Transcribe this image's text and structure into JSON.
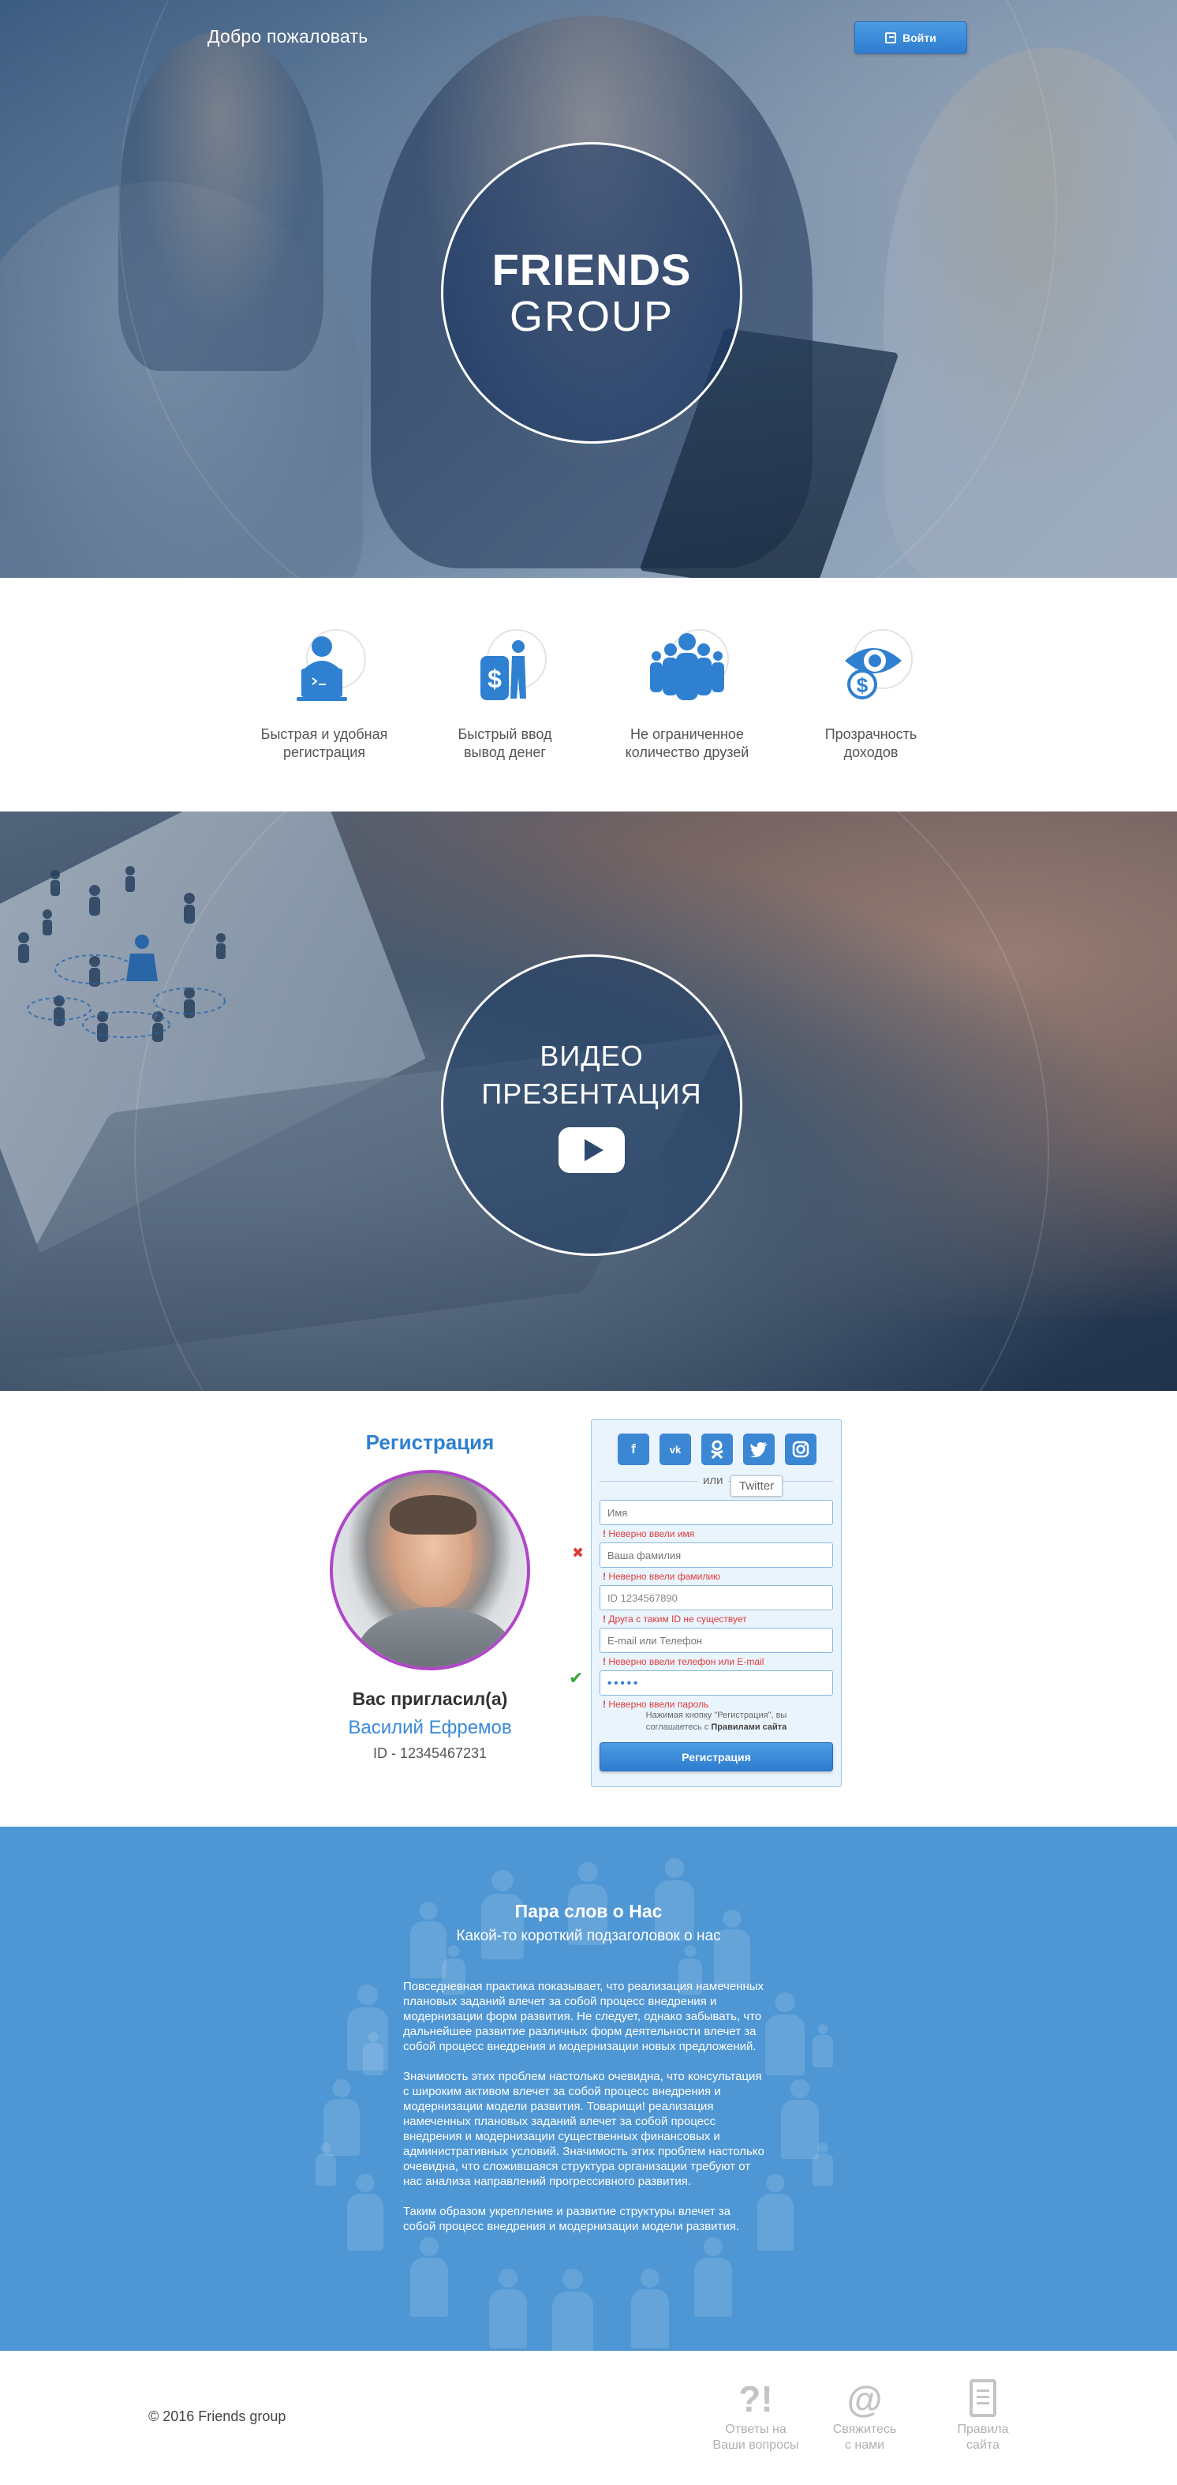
{
  "header": {
    "welcome": "Добро пожаловать",
    "login_label": "Войти",
    "logo_line1": "FRIENDS",
    "logo_line2": "GROUP"
  },
  "features": [
    {
      "icon": "user-laptop-icon",
      "line1": "Быстрая и удобная",
      "line2": "регистрация"
    },
    {
      "icon": "money-person-icon",
      "line1": "Быстрый ввод",
      "line2": "вывод денег"
    },
    {
      "icon": "group-people-icon",
      "line1": "Не ограниченное",
      "line2": "количество друзей"
    },
    {
      "icon": "eye-dollar-icon",
      "line1": "Прозрачность",
      "line2": "доходов"
    }
  ],
  "video": {
    "line1": "ВИДЕО",
    "line2": "ПРЕЗЕНТАЦИЯ"
  },
  "registration": {
    "title": "Регистрация",
    "invited_label": "Вас пригласил(а)",
    "inviter_name": "Василий Ефремов",
    "inviter_id": "ID - 12345467231",
    "socials": [
      "f",
      "vk",
      "ok",
      "twitter",
      "instagram"
    ],
    "or_label": "или",
    "tooltip": "Twitter",
    "fields": {
      "first_name_placeholder": "Имя",
      "last_name_placeholder": "Ваша фамилия",
      "id_value": "ID 1234567890",
      "contact_placeholder": "E-mail или Телефон",
      "password_value": "•••••"
    },
    "errors": {
      "first_name": "Неверно ввели имя",
      "last_name": "Неверно ввели фамилию",
      "id": "Друга с таким ID не существует",
      "contact": "Неверно ввели телефон или E-mail",
      "password": "Неверно ввели пароль"
    },
    "agree_line1": "Нажимая кнопку \"Регистрация\", вы",
    "agree_line2_prefix": "соглашаетесь с ",
    "agree_link": "Правилами сайта",
    "submit_label": "Регистрация"
  },
  "about": {
    "title": "Пара слов о Нас",
    "subtitle": "Какой-то короткий подзаголовок о нас",
    "paragraphs": [
      "Повседневная практика показывает, что реализация намеченных плановых заданий влечет за собой процесс внедрения и модернизации форм развития. Не следует, однако забывать, что дальнейшее развитие различных форм деятельности влечет за собой процесс внедрения и модернизации новых предложений.",
      "Значимость этих проблем настолько очевидна, что консультация с широким активом влечет за собой процесс внедрения и модернизации модели развития. Товарищи! реализация намеченных плановых заданий влечет за собой процесс внедрения и модернизации существенных финансовых и административных условий. Значимость этих проблем настолько очевидна, что сложившаяся структура организации требуют от нас анализа направлений прогрессивного развития.",
      "Таким образом укрепление и развитие структуры влечет за собой процесс внедрения и модернизации модели развития."
    ]
  },
  "footer": {
    "copyright": "© 2016 Friends group",
    "links": [
      {
        "icon": "question-icon",
        "glyph": "?!",
        "line1": "Ответы на",
        "line2": "Ваши вопросы"
      },
      {
        "icon": "at-icon",
        "glyph": "@",
        "line1": "Свяжитесь",
        "line2": "с нами"
      },
      {
        "icon": "document-icon",
        "glyph": "",
        "line1": "Правила",
        "line2": "сайта"
      }
    ]
  },
  "colors": {
    "brand_blue": "#2f80d1",
    "about_bg": "#4f97d4",
    "error_red": "#e03a3a",
    "avatar_ring": "#b046c9"
  }
}
